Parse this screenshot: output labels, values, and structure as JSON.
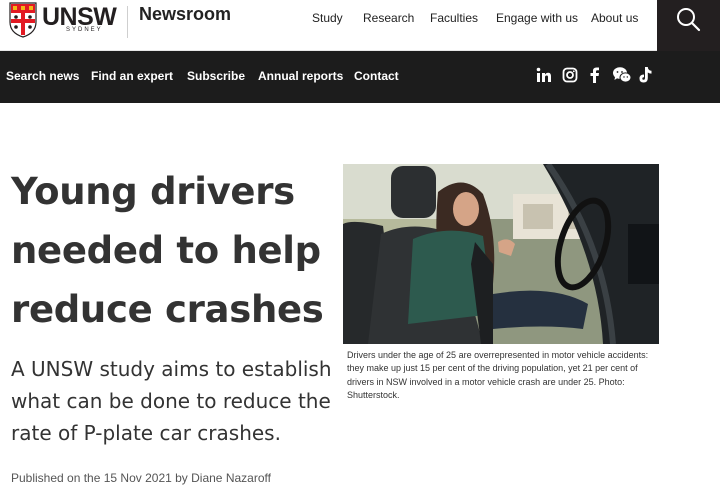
{
  "brand": {
    "logo_text": "UNSW",
    "logo_subtext": "SYDNEY",
    "site_title": "Newsroom"
  },
  "top_nav": {
    "items": [
      "Study",
      "Research",
      "Faculties",
      "Engage with us",
      "About us"
    ]
  },
  "search": {
    "icon": "search-icon"
  },
  "secondary_nav": {
    "items": [
      "Search news",
      "Find an expert",
      "Subscribe",
      "Annual reports",
      "Contact"
    ],
    "social": [
      "linkedin-icon",
      "instagram-icon",
      "facebook-icon",
      "wechat-icon",
      "tiktok-icon"
    ]
  },
  "article": {
    "headline_lines": [
      "Young drivers",
      "needed to help",
      "reduce crashes"
    ],
    "standfirst_lines": [
      "A UNSW study aims to establish",
      "what can be done to reduce the",
      "rate of P-plate car crashes."
    ],
    "byline": "Published on the 15 Nov 2021 by Diane Nazaroff",
    "image_caption_lines": [
      "Drivers under the age of 25 are overrepresented in motor vehicle accidents:",
      "they make up just 15 per cent of the driving population, yet 21 per cent of",
      "drivers in NSW involved in a motor vehicle crash are under 25. Photo:",
      "Shutterstock."
    ]
  },
  "colors": {
    "nav_bg": "#1c1c1c",
    "search_bg": "#231f20",
    "crest_red": "#e21a23",
    "crest_gold": "#f2b817"
  }
}
